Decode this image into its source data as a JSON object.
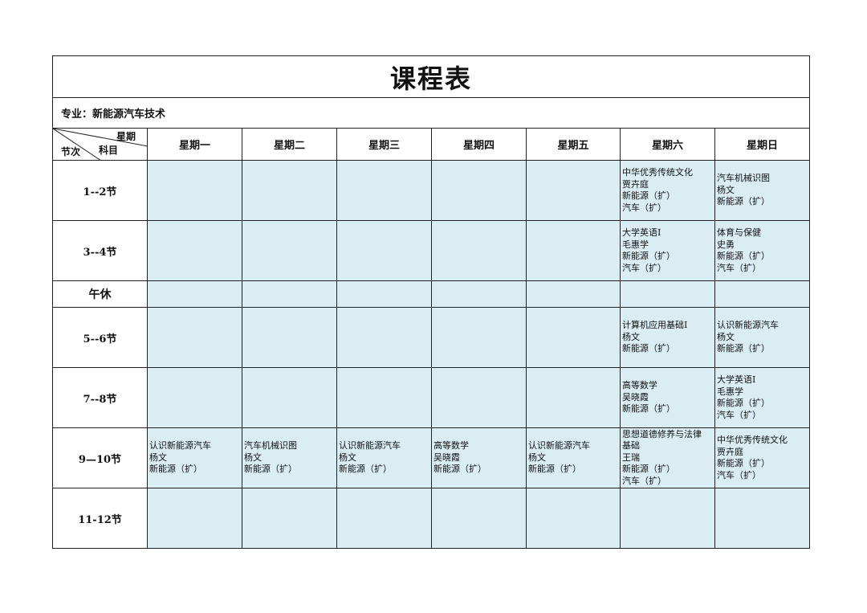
{
  "title": "课程表",
  "major": "专业：新能源汽车技术",
  "corner": {
    "top_right": "星期",
    "middle": "科目",
    "bottom_left": "节次"
  },
  "days": [
    "星期一",
    "星期二",
    "星期三",
    "星期四",
    "星期五",
    "星期六",
    "星期日"
  ],
  "rows": [
    {
      "label": "1--2节",
      "cells": [
        [],
        [],
        [],
        [],
        [],
        [
          "中华优秀传统文化",
          "贾卉庭",
          "新能源（扩）",
          "汽车（扩）"
        ],
        [
          "汽车机械识图",
          "杨文",
          "新能源（扩）"
        ]
      ]
    },
    {
      "label": "3--4节",
      "cells": [
        [],
        [],
        [],
        [],
        [],
        [
          "大学英语Ⅰ",
          "毛惠学",
          "新能源（扩）",
          "汽车（扩）"
        ],
        [
          "体育与保健",
          "史勇",
          "新能源（扩）",
          "汽车（扩）"
        ]
      ]
    },
    {
      "label": "午休",
      "cells": [
        [],
        [],
        [],
        [],
        [],
        [],
        []
      ]
    },
    {
      "label": "5--6节",
      "cells": [
        [],
        [],
        [],
        [],
        [],
        [
          "计算机应用基础Ⅰ",
          "杨文",
          "新能源（扩）"
        ],
        [
          "认识新能源汽车",
          "杨文",
          "新能源（扩）"
        ]
      ]
    },
    {
      "label": "7--8节",
      "cells": [
        [],
        [],
        [],
        [],
        [],
        [
          "高等数学",
          "吴晓霞",
          "新能源（扩）"
        ],
        [
          "大学英语Ⅰ",
          "毛惠学",
          "新能源（扩）",
          "汽车（扩）"
        ]
      ]
    },
    {
      "label": "9—10节",
      "cells": [
        [
          "认识新能源汽车",
          "杨文",
          "新能源（扩）"
        ],
        [
          "汽车机械识图",
          "杨文",
          "新能源（扩）"
        ],
        [
          "认识新能源汽车",
          "杨文",
          "新能源（扩）"
        ],
        [
          "高等数学",
          "吴晓霞",
          "新能源（扩）"
        ],
        [
          "认识新能源汽车",
          "杨文",
          "新能源（扩）"
        ],
        [
          "思想道德修养与法律",
          "基础",
          "王瑞",
          "新能源（扩）",
          "汽车（扩）"
        ],
        [
          "中华优秀传统文化",
          "贾卉庭",
          "新能源（扩）",
          "汽车（扩）"
        ]
      ]
    },
    {
      "label": "11-12节",
      "cells": [
        [],
        [],
        [],
        [],
        [],
        [],
        []
      ]
    }
  ],
  "colors": {
    "cell_bg": "#daedf3",
    "border": "#222222"
  }
}
